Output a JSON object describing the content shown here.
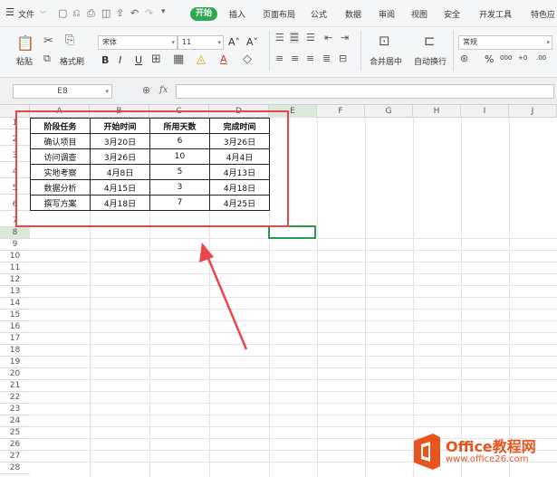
{
  "menu": {
    "file": "文件",
    "start": "开始",
    "tabs": [
      "插入",
      "页面布局",
      "公式",
      "数据",
      "审阅",
      "视图",
      "安全",
      "开发工具",
      "特色应"
    ]
  },
  "ribbon": {
    "paste": "粘贴",
    "format_painter": "格式刷",
    "font_name": "宋体",
    "font_size": "11",
    "bold": "B",
    "italic": "I",
    "underline": "U",
    "merge_center": "合并居中",
    "wrap_text": "自动换行",
    "number_format": "常规",
    "percent": "%"
  },
  "formula_bar": {
    "cell_ref": "E8",
    "fx": "fx",
    "value": ""
  },
  "columns": [
    "A",
    "B",
    "C",
    "D",
    "E",
    "F",
    "G",
    "H",
    "I",
    "J"
  ],
  "rows": [
    "1",
    "2",
    "3",
    "4",
    "5",
    "6",
    "7",
    "8",
    "9",
    "10",
    "11",
    "12",
    "13",
    "14",
    "15",
    "16",
    "17",
    "18",
    "19",
    "20",
    "21",
    "22",
    "23",
    "24",
    "25",
    "26",
    "27",
    "28"
  ],
  "table": {
    "headers": [
      "阶段任务",
      "开始时间",
      "所用天数",
      "完成时间"
    ],
    "rows": [
      [
        "确认项目",
        "3月20日",
        "6",
        "3月26日"
      ],
      [
        "访问调查",
        "3月26日",
        "10",
        "4月4日"
      ],
      [
        "实地考察",
        "4月8日",
        "5",
        "4月13日"
      ],
      [
        "数据分析",
        "4月15日",
        "3",
        "4月18日"
      ],
      [
        "撰写方案",
        "4月18日",
        "7",
        "4月25日"
      ]
    ]
  },
  "watermark": {
    "brand": "Office教程网",
    "url": "www.office26.com"
  },
  "colors": {
    "accent_green": "#2fa84f",
    "annotation_red": "#e8464b",
    "brand_orange": "#e8541e"
  }
}
